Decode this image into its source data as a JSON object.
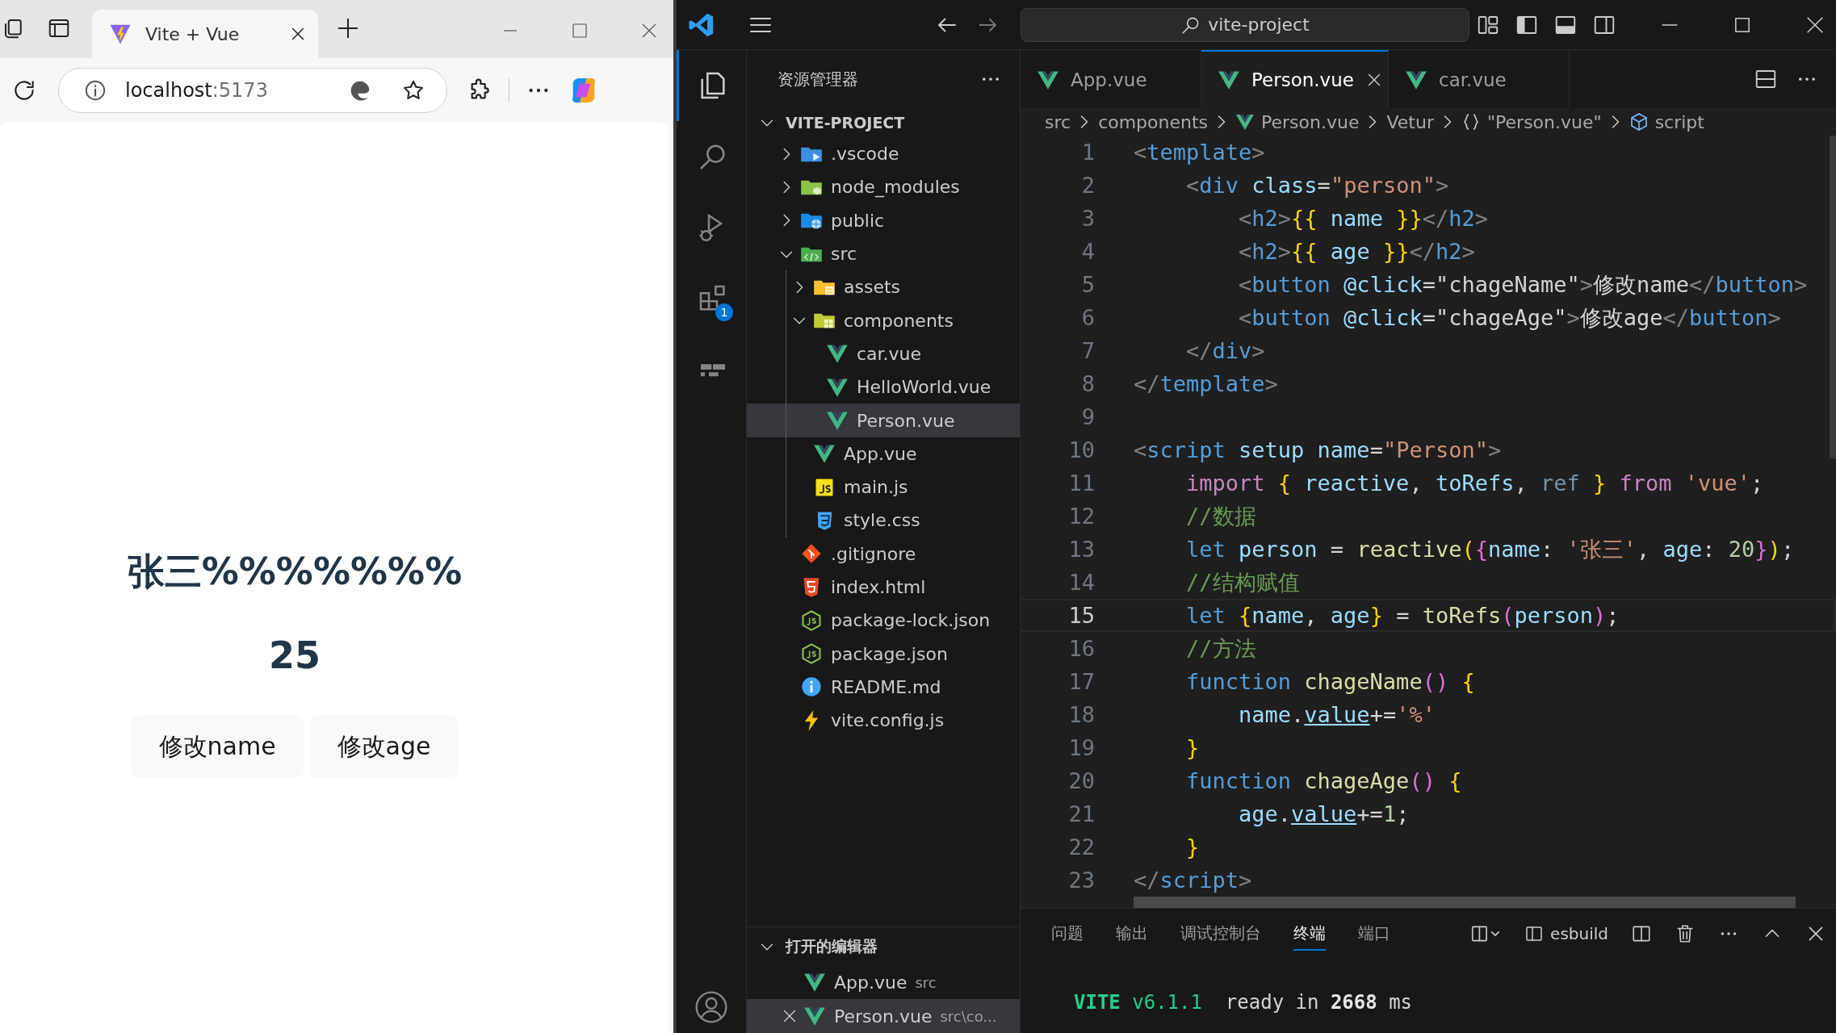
{
  "browser": {
    "tabs": [
      {
        "title": "Vite + Vue",
        "selected": true
      }
    ],
    "address": {
      "host": "localhost",
      "port": ":5173"
    },
    "page": {
      "name": "张三%%%%%%%",
      "age": "25",
      "buttons": [
        {
          "label": "修改name"
        },
        {
          "label": "修改age"
        }
      ]
    }
  },
  "vscode": {
    "search": "vite-project",
    "activity": [
      {
        "kind": "explorer",
        "selected": true
      },
      {
        "kind": "search",
        "selected": false
      },
      {
        "kind": "debug",
        "selected": false
      },
      {
        "kind": "extensions",
        "selected": false,
        "badge": "1"
      },
      {
        "kind": "remote",
        "selected": false
      }
    ],
    "explorer": {
      "title": "资源管理器",
      "project": {
        "label": "VITE-PROJECT",
        "expanded": true,
        "children": [
          {
            "label": ".vscode",
            "kind": "vscode-folder",
            "expanded": false,
            "selected": false
          },
          {
            "label": "node_modules",
            "kind": "node-folder",
            "expanded": false,
            "selected": false
          },
          {
            "label": "public",
            "kind": "public-folder",
            "expanded": false,
            "selected": false
          },
          {
            "label": "src",
            "kind": "src-folder",
            "expanded": true,
            "selected": false,
            "children": [
              {
                "label": "assets",
                "kind": "assets-folder",
                "expanded": false,
                "selected": false
              },
              {
                "label": "components",
                "kind": "components-folder",
                "expanded": true,
                "selected": false,
                "children": [
                  {
                    "label": "car.vue",
                    "kind": "vue",
                    "selected": false
                  },
                  {
                    "label": "HelloWorld.vue",
                    "kind": "vue",
                    "selected": false
                  },
                  {
                    "label": "Person.vue",
                    "kind": "vue",
                    "selected": true
                  }
                ]
              },
              {
                "label": "App.vue",
                "kind": "vue",
                "selected": false
              },
              {
                "label": "main.js",
                "kind": "js",
                "selected": false
              },
              {
                "label": "style.css",
                "kind": "css",
                "selected": false
              }
            ]
          },
          {
            "label": ".gitignore",
            "kind": "git",
            "selected": false
          },
          {
            "label": "index.html",
            "kind": "html",
            "selected": false
          },
          {
            "label": "package-lock.json",
            "kind": "node",
            "selected": false
          },
          {
            "label": "package.json",
            "kind": "node",
            "selected": false
          },
          {
            "label": "README.md",
            "kind": "info",
            "selected": false
          },
          {
            "label": "vite.config.js",
            "kind": "vite",
            "selected": false
          }
        ]
      }
    },
    "open_editors": {
      "title": "打开的编辑器",
      "expanded": true,
      "items": [
        {
          "label": "App.vue",
          "kind": "vue",
          "detail": "src",
          "selected": false
        },
        {
          "label": "Person.vue",
          "kind": "vue",
          "detail": "src\\co...",
          "selected": true
        }
      ]
    },
    "tabs": [
      {
        "label": "App.vue",
        "selected": false
      },
      {
        "label": "Person.vue",
        "selected": true
      },
      {
        "label": "car.vue",
        "selected": false
      }
    ],
    "breadcrumbs": [
      {
        "kind": "folder",
        "label": "src"
      },
      {
        "kind": "folder",
        "label": "components"
      },
      {
        "kind": "vue",
        "label": "Person.vue"
      },
      {
        "kind": "folder",
        "label": "Vetur"
      },
      {
        "kind": "object",
        "label": "\"Person.vue\""
      },
      {
        "kind": "element",
        "label": "script"
      }
    ],
    "lines": [
      {
        "number": "1",
        "selected": false,
        "tokens": [
          {
            "text": "<",
            "kind": "punct"
          },
          {
            "text": "template",
            "kind": "tag"
          },
          {
            "text": ">",
            "kind": "punct"
          }
        ]
      },
      {
        "number": "2",
        "selected": false,
        "tokens": [
          {
            "text": "    <",
            "kind": "punct"
          },
          {
            "text": "div",
            "kind": "tag"
          },
          {
            "text": " class",
            "kind": "attr"
          },
          {
            "text": "=",
            "kind": "plain"
          },
          {
            "text": "\"person\"",
            "kind": "string"
          },
          {
            "text": ">",
            "kind": "punct"
          }
        ]
      },
      {
        "number": "3",
        "selected": false,
        "tokens": [
          {
            "text": "        <",
            "kind": "punct"
          },
          {
            "text": "h2",
            "kind": "tag"
          },
          {
            "text": ">",
            "kind": "punct"
          },
          {
            "text": "{{",
            "kind": "bracket"
          },
          {
            "text": " name ",
            "kind": "attr"
          },
          {
            "text": "}}",
            "kind": "bracket"
          },
          {
            "text": "</",
            "kind": "punct"
          },
          {
            "text": "h2",
            "kind": "tag"
          },
          {
            "text": ">",
            "kind": "punct"
          }
        ]
      },
      {
        "number": "4",
        "selected": false,
        "tokens": [
          {
            "text": "        <",
            "kind": "punct"
          },
          {
            "text": "h2",
            "kind": "tag"
          },
          {
            "text": ">",
            "kind": "punct"
          },
          {
            "text": "{{",
            "kind": "bracket"
          },
          {
            "text": " age ",
            "kind": "attr"
          },
          {
            "text": "}}",
            "kind": "bracket"
          },
          {
            "text": "</",
            "kind": "punct"
          },
          {
            "text": "h2",
            "kind": "tag"
          },
          {
            "text": ">",
            "kind": "punct"
          }
        ]
      },
      {
        "number": "5",
        "selected": false,
        "tokens": [
          {
            "text": "        <",
            "kind": "punct"
          },
          {
            "text": "button",
            "kind": "tag"
          },
          {
            "text": " @click",
            "kind": "attr"
          },
          {
            "text": "=\"chageName\"",
            "kind": "plain"
          },
          {
            "text": ">",
            "kind": "punct"
          },
          {
            "text": "修改name",
            "kind": "plain"
          },
          {
            "text": "</",
            "kind": "punct"
          },
          {
            "text": "button",
            "kind": "tag"
          },
          {
            "text": ">",
            "kind": "punct"
          }
        ]
      },
      {
        "number": "6",
        "selected": false,
        "tokens": [
          {
            "text": "        <",
            "kind": "punct"
          },
          {
            "text": "button",
            "kind": "tag"
          },
          {
            "text": " @click",
            "kind": "attr"
          },
          {
            "text": "=\"chageAge\"",
            "kind": "plain"
          },
          {
            "text": ">",
            "kind": "punct"
          },
          {
            "text": "修改age",
            "kind": "plain"
          },
          {
            "text": "</",
            "kind": "punct"
          },
          {
            "text": "button",
            "kind": "tag"
          },
          {
            "text": ">",
            "kind": "punct"
          }
        ]
      },
      {
        "number": "7",
        "selected": false,
        "tokens": [
          {
            "text": "    </",
            "kind": "punct"
          },
          {
            "text": "div",
            "kind": "tag"
          },
          {
            "text": ">",
            "kind": "punct"
          }
        ]
      },
      {
        "number": "8",
        "selected": false,
        "tokens": [
          {
            "text": "</",
            "kind": "punct"
          },
          {
            "text": "template",
            "kind": "tag"
          },
          {
            "text": ">",
            "kind": "punct"
          }
        ]
      },
      {
        "number": "9",
        "selected": false
      },
      {
        "number": "10",
        "selected": false,
        "tokens": [
          {
            "text": "<",
            "kind": "punct"
          },
          {
            "text": "script",
            "kind": "tag"
          },
          {
            "text": " setup name",
            "kind": "attr"
          },
          {
            "text": "=",
            "kind": "plain"
          },
          {
            "text": "\"Person\"",
            "kind": "string"
          },
          {
            "text": ">",
            "kind": "punct"
          }
        ]
      },
      {
        "number": "11",
        "selected": false,
        "tokens": [
          {
            "text": "    import",
            "kind": "control"
          },
          {
            "text": " {",
            "kind": "bracket"
          },
          {
            "text": " reactive",
            "kind": "attr"
          },
          {
            "text": ", ",
            "kind": "plain"
          },
          {
            "text": "toRefs",
            "kind": "attr"
          },
          {
            "text": ", ",
            "kind": "plain"
          },
          {
            "text": "ref",
            "kind": "unused"
          },
          {
            "text": " }",
            "kind": "bracket"
          },
          {
            "text": " from",
            "kind": "control"
          },
          {
            "text": " 'vue'",
            "kind": "string"
          },
          {
            "text": ";",
            "kind": "plain"
          }
        ]
      },
      {
        "number": "12",
        "selected": false,
        "tokens": [
          {
            "text": "    //数据",
            "kind": "comment"
          }
        ]
      },
      {
        "number": "13",
        "selected": false,
        "tokens": [
          {
            "text": "    let",
            "kind": "keyword"
          },
          {
            "text": " person",
            "kind": "attr"
          },
          {
            "text": " = ",
            "kind": "plain"
          },
          {
            "text": "reactive",
            "kind": "function"
          },
          {
            "text": "(",
            "kind": "bracket"
          },
          {
            "text": "{",
            "kind": "bracket2"
          },
          {
            "text": "name",
            "kind": "attr"
          },
          {
            "text": ": ",
            "kind": "plain"
          },
          {
            "text": "'张三'",
            "kind": "string"
          },
          {
            "text": ", ",
            "kind": "plain"
          },
          {
            "text": "age",
            "kind": "attr"
          },
          {
            "text": ": ",
            "kind": "plain"
          },
          {
            "text": "20",
            "kind": "number"
          },
          {
            "text": "}",
            "kind": "bracket2"
          },
          {
            "text": ")",
            "kind": "bracket"
          },
          {
            "text": ";",
            "kind": "plain"
          }
        ]
      },
      {
        "number": "14",
        "selected": false,
        "tokens": [
          {
            "text": "    //结构赋值",
            "kind": "comment"
          }
        ]
      },
      {
        "number": "15",
        "selected": true,
        "tokens": [
          {
            "text": "    let",
            "kind": "keyword"
          },
          {
            "text": " {",
            "kind": "bracket"
          },
          {
            "text": "name",
            "kind": "attr"
          },
          {
            "text": ", ",
            "kind": "plain"
          },
          {
            "text": "age",
            "kind": "attr"
          },
          {
            "text": "}",
            "kind": "bracket"
          },
          {
            "text": " = ",
            "kind": "plain"
          },
          {
            "text": "toRefs",
            "kind": "function"
          },
          {
            "text": "(",
            "kind": "bracket2"
          },
          {
            "text": "person",
            "kind": "attr"
          },
          {
            "text": ")",
            "kind": "bracket2"
          },
          {
            "text": ";",
            "kind": "plain"
          }
        ]
      },
      {
        "number": "16",
        "selected": false,
        "tokens": [
          {
            "text": "    //方法",
            "kind": "comment"
          }
        ]
      },
      {
        "number": "17",
        "selected": false,
        "tokens": [
          {
            "text": "    function",
            "kind": "keyword"
          },
          {
            "text": " chageName",
            "kind": "function"
          },
          {
            "text": "()",
            "kind": "bracket2"
          },
          {
            "text": " {",
            "kind": "bracket"
          }
        ]
      },
      {
        "number": "18",
        "selected": false,
        "tokens": [
          {
            "text": "        name",
            "kind": "attr"
          },
          {
            "text": ".",
            "kind": "plain"
          },
          {
            "text": "value",
            "kind": "underlined"
          },
          {
            "text": "+=",
            "kind": "plain"
          },
          {
            "text": "'%'",
            "kind": "string"
          }
        ]
      },
      {
        "number": "19",
        "selected": false,
        "tokens": [
          {
            "text": "    }",
            "kind": "bracket"
          }
        ]
      },
      {
        "number": "20",
        "selected": false,
        "tokens": [
          {
            "text": "    function",
            "kind": "keyword"
          },
          {
            "text": " chageAge",
            "kind": "function"
          },
          {
            "text": "()",
            "kind": "bracket2"
          },
          {
            "text": " {",
            "kind": "bracket"
          }
        ]
      },
      {
        "number": "21",
        "selected": false,
        "tokens": [
          {
            "text": "        age",
            "kind": "attr"
          },
          {
            "text": ".",
            "kind": "plain"
          },
          {
            "text": "value",
            "kind": "underlined"
          },
          {
            "text": "+=",
            "kind": "plain"
          },
          {
            "text": "1",
            "kind": "number"
          },
          {
            "text": ";",
            "kind": "plain"
          }
        ]
      },
      {
        "number": "22",
        "selected": false,
        "tokens": [
          {
            "text": "    }",
            "kind": "bracket"
          }
        ]
      },
      {
        "number": "23",
        "selected": false,
        "tokens": [
          {
            "text": "</",
            "kind": "punct"
          },
          {
            "text": "script",
            "kind": "tag"
          },
          {
            "text": ">",
            "kind": "punct"
          }
        ]
      }
    ],
    "panel": {
      "tabs": [
        {
          "label": "问题",
          "selected": false
        },
        {
          "label": "输出",
          "selected": false
        },
        {
          "label": "调试控制台",
          "selected": false
        },
        {
          "label": "终端",
          "selected": true
        },
        {
          "label": "端口",
          "selected": false
        }
      ],
      "terminal_profile": "esbuild",
      "terminal": [
        [
          {
            "text": "VITE",
            "kind": "brand"
          },
          {
            "text": " v6.1.1",
            "kind": "green"
          },
          {
            "text": "  ready in ",
            "kind": "plain"
          },
          {
            "text": "2668",
            "kind": "bold"
          },
          {
            "text": " ms",
            "kind": "plain"
          }
        ]
      ]
    }
  }
}
